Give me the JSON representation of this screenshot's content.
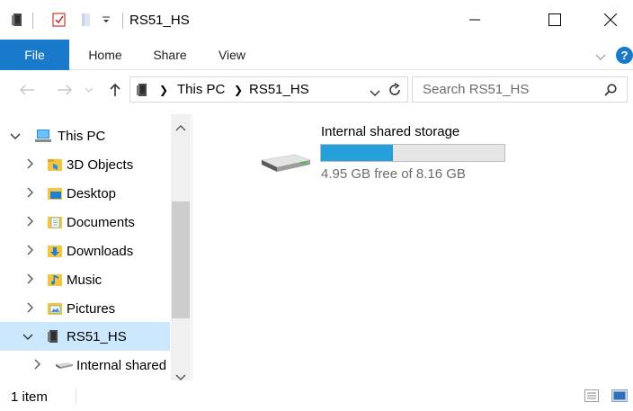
{
  "window": {
    "title": "RS51_HS"
  },
  "ribbon": {
    "tabs": [
      "File",
      "Home",
      "Share",
      "View"
    ],
    "help_label": "?"
  },
  "address": {
    "crumbs": [
      "This PC",
      "RS51_HS"
    ],
    "search_placeholder": "Search RS51_HS"
  },
  "nav": {
    "items": [
      {
        "label": "This PC",
        "expanded": true,
        "icon": "this-pc-icon"
      },
      {
        "label": "3D Objects",
        "icon": "3d-objects-folder-icon"
      },
      {
        "label": "Desktop",
        "icon": "desktop-folder-icon"
      },
      {
        "label": "Documents",
        "icon": "documents-folder-icon"
      },
      {
        "label": "Downloads",
        "icon": "downloads-folder-icon"
      },
      {
        "label": "Music",
        "icon": "music-folder-icon"
      },
      {
        "label": "Pictures",
        "icon": "pictures-folder-icon"
      },
      {
        "label": "RS51_HS",
        "expanded": true,
        "selected": true,
        "icon": "device-icon"
      },
      {
        "label": "Internal shared",
        "icon": "drive-icon"
      }
    ]
  },
  "content": {
    "drive": {
      "name": "Internal shared storage",
      "free_text": "4.95 GB free of 8.16 GB",
      "used_fraction": 0.393
    }
  },
  "status": {
    "item_count": "1 item"
  },
  "colors": {
    "accent": "#1979ca",
    "selection": "#cce8ff",
    "bar_fill": "#26a0da"
  }
}
